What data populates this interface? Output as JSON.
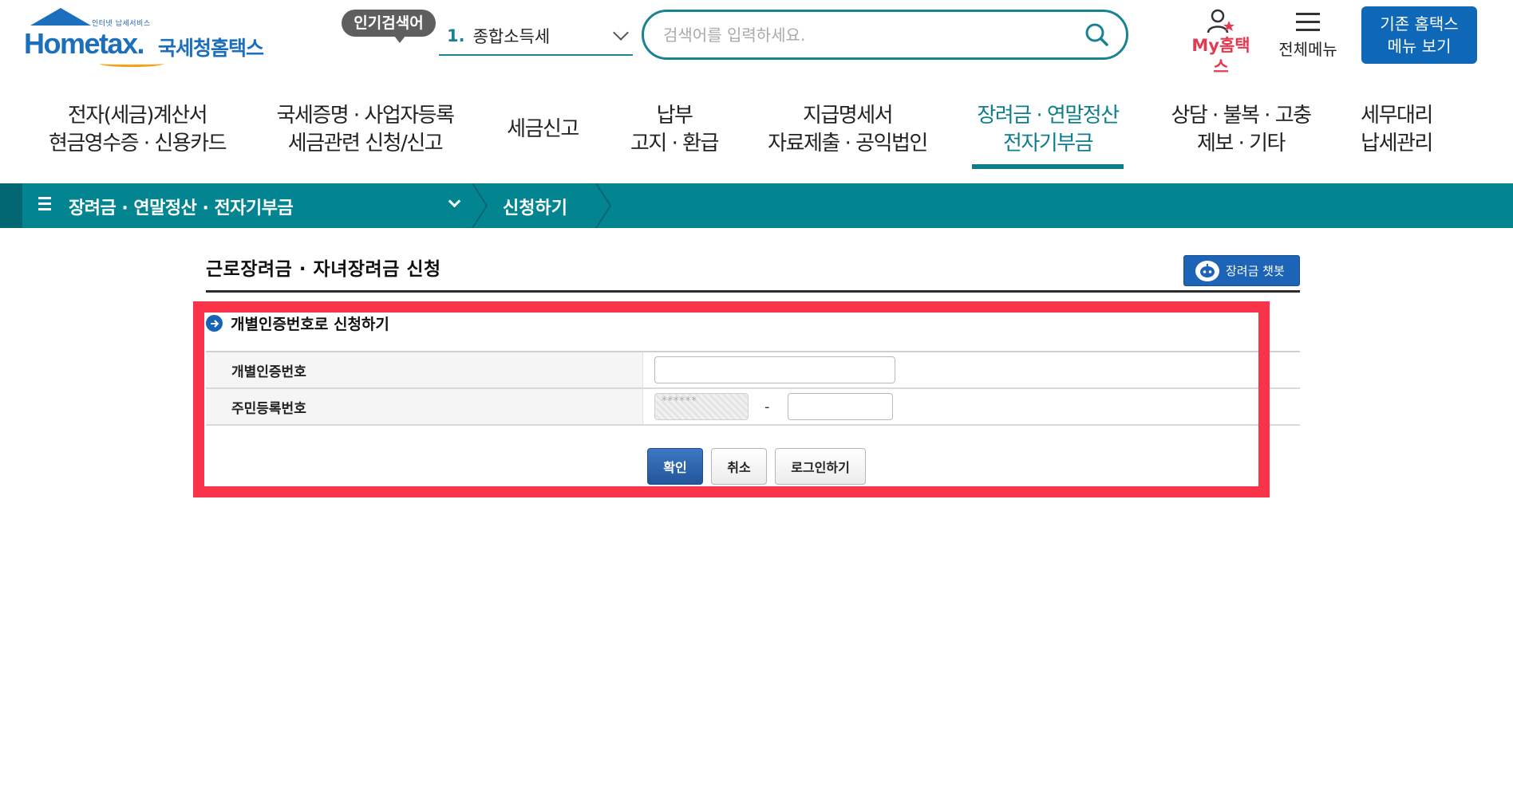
{
  "header": {
    "logo_tagline": "인터넷 납세서비스",
    "logo_text": "Hometax.",
    "logo_korean": "국세청홈택스",
    "popular_badge": "인기검색어",
    "popular_rank": "1.",
    "popular_keyword": "종합소득세",
    "search_placeholder": "검색어를 입력하세요.",
    "my_hometax": "My홈택스",
    "all_menu": "전체메뉴",
    "old_menu_line1": "기존 홈택스",
    "old_menu_line2": "메뉴 보기"
  },
  "gnb": [
    {
      "line1": "전자(세금)계산서",
      "line2": "현금영수증 · 신용카드"
    },
    {
      "line1": "국세증명 · 사업자등록",
      "line2": "세금관련 신청/신고"
    },
    {
      "line1": "세금신고",
      "line2": ""
    },
    {
      "line1": "납부",
      "line2": "고지 · 환급"
    },
    {
      "line1": "지급명세서",
      "line2": "자료제출 · 공익법인"
    },
    {
      "line1": "장려금 · 연말정산",
      "line2": "전자기부금"
    },
    {
      "line1": "상담 · 불복 · 고충",
      "line2": "제보 · 기타"
    },
    {
      "line1": "세무대리",
      "line2": "납세관리"
    }
  ],
  "breadcrumb": {
    "level1": "장려금 · 연말정산 · 전자기부금",
    "level2": "신청하기"
  },
  "page": {
    "title": "근로장려금 · 자녀장려금 신청",
    "chatbot_label": "장려금 챗봇",
    "section_title": "개별인증번호로 신청하기",
    "field_auth_label": "개별인증번호",
    "field_auth_value": "",
    "field_rrn_label": "주민등록번호",
    "field_rrn_front_masked": "******",
    "field_rrn_dash": "-",
    "field_rrn_back_value": "",
    "btn_confirm": "확인",
    "btn_cancel": "취소",
    "btn_login": "로그인하기"
  },
  "colors": {
    "teal": "#038491",
    "brand_blue": "#1b6fbd",
    "highlight_red": "#f8334a",
    "my_hometax_pink": "#e23a52"
  }
}
